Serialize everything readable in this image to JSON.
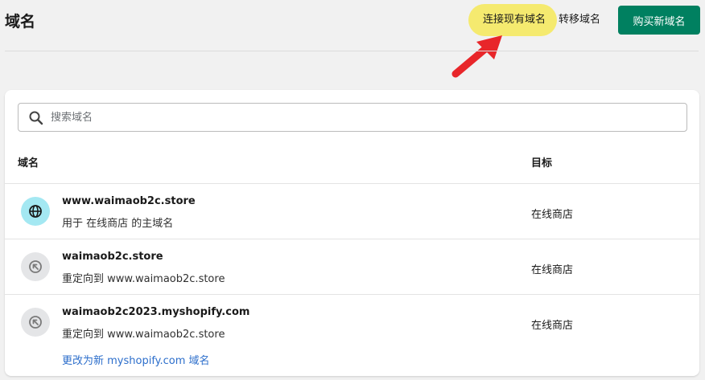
{
  "page": {
    "title": "域名"
  },
  "header": {
    "connect_label": "连接现有域名",
    "transfer_label": "转移域名",
    "buy_label": "购买新域名"
  },
  "search": {
    "placeholder": "搜索域名"
  },
  "table": {
    "columns": {
      "domain": "域名",
      "target": "目标"
    },
    "rows": [
      {
        "name": "www.waimaob2c.store",
        "subtitle": "用于 在线商店 的主域名",
        "target": "在线商店",
        "icon": "globe-icon"
      },
      {
        "name": "waimaob2c.store",
        "subtitle": "重定向到 www.waimaob2c.store",
        "target": "在线商店",
        "icon": "redirect-icon"
      },
      {
        "name": "waimaob2c2023.myshopify.com",
        "subtitle": "重定向到 www.waimaob2c.store",
        "target": "在线商店",
        "icon": "redirect-icon",
        "link": "更改为新 myshopify.com 域名"
      }
    ]
  },
  "colors": {
    "primary_button": "#008060",
    "highlight": "#f5ea6f",
    "arrow": "#e8262a",
    "link": "#2c6ecb",
    "primary_icon_bg": "#a4e8f2"
  }
}
